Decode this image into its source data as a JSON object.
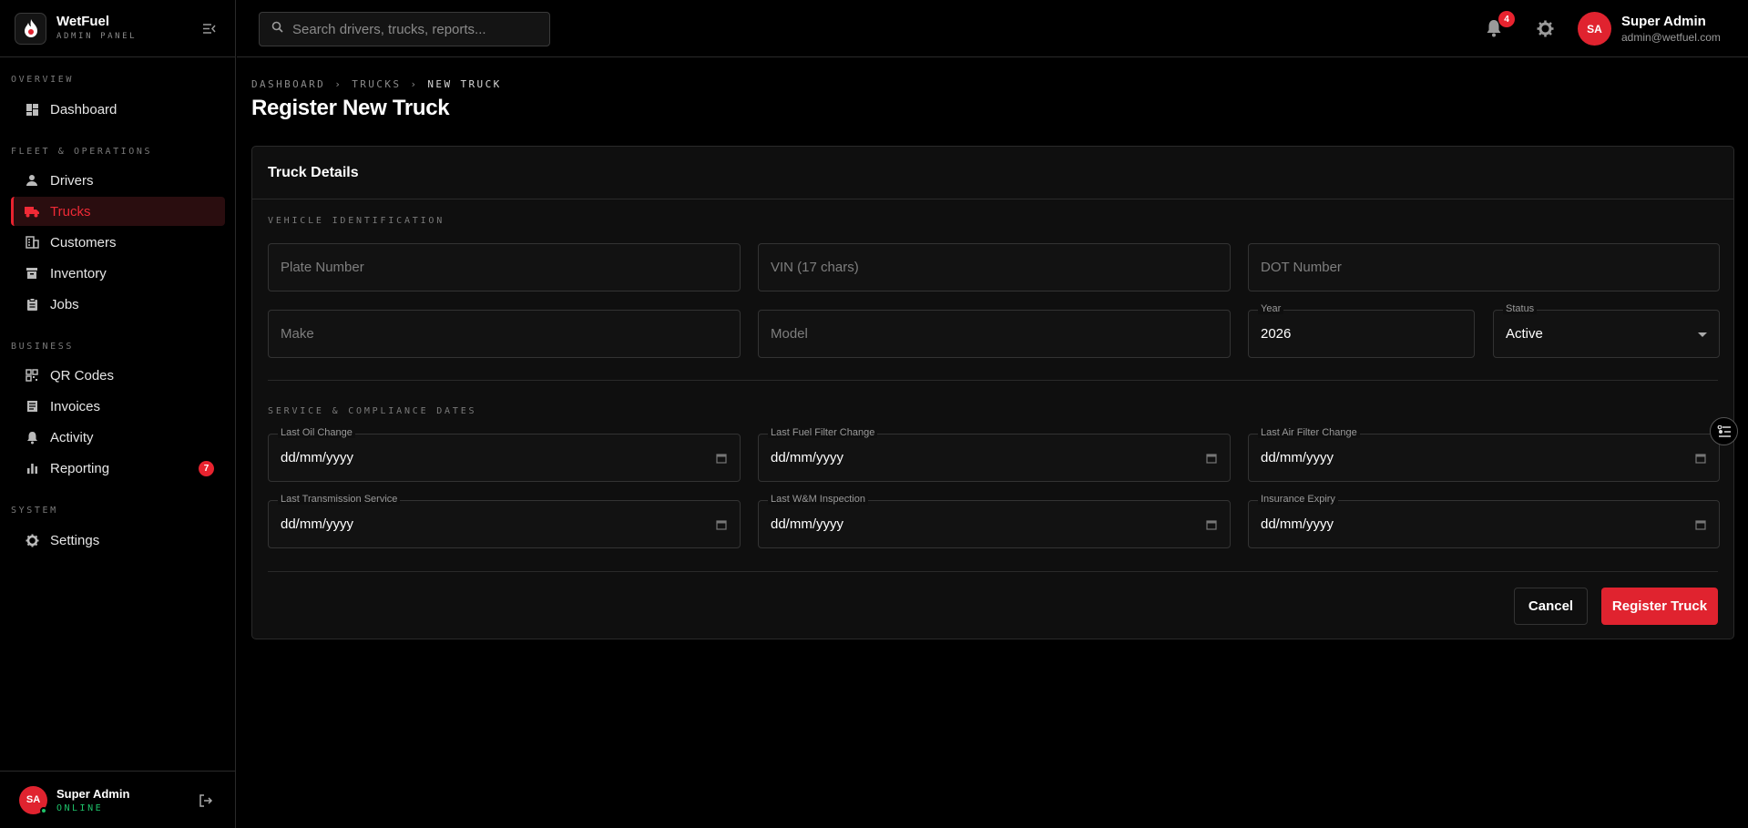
{
  "brand": {
    "name": "WetFuel",
    "subtitle": "ADMIN PANEL"
  },
  "sidebar": {
    "sections": [
      {
        "label": "OVERVIEW"
      },
      {
        "label": "FLEET & OPERATIONS"
      },
      {
        "label": "BUSINESS"
      },
      {
        "label": "SYSTEM"
      }
    ],
    "items": [
      {
        "label": "Dashboard",
        "icon": "dashboard-icon"
      },
      {
        "label": "Drivers",
        "icon": "person-icon"
      },
      {
        "label": "Trucks",
        "icon": "truck-icon",
        "active": true
      },
      {
        "label": "Customers",
        "icon": "building-icon"
      },
      {
        "label": "Inventory",
        "icon": "archive-icon"
      },
      {
        "label": "Jobs",
        "icon": "clipboard-icon"
      },
      {
        "label": "QR Codes",
        "icon": "qr-code-icon"
      },
      {
        "label": "Invoices",
        "icon": "receipt-icon"
      },
      {
        "label": "Activity",
        "icon": "bell-icon"
      },
      {
        "label": "Reporting",
        "icon": "bar-chart-icon",
        "badge": "7"
      },
      {
        "label": "Settings",
        "icon": "gear-icon"
      }
    ],
    "footer": {
      "initials": "SA",
      "name": "Super Admin",
      "status": "ONLINE"
    }
  },
  "topbar": {
    "search_placeholder": "Search drivers, trucks, reports...",
    "notification_count": "4",
    "user": {
      "initials": "SA",
      "name": "Super Admin",
      "email": "admin@wetfuel.com"
    }
  },
  "breadcrumb": [
    "DASHBOARD",
    "TRUCKS",
    "NEW TRUCK"
  ],
  "breadcrumb_separator": "›",
  "page_title": "Register New Truck",
  "form": {
    "card_title": "Truck Details",
    "vehicle_section": "VEHICLE IDENTIFICATION",
    "plate_placeholder": "Plate Number",
    "vin_placeholder": "VIN (17 chars)",
    "dot_placeholder": "DOT Number",
    "make_placeholder": "Make",
    "model_placeholder": "Model",
    "year_label": "Year",
    "year_value": "2026",
    "status_label": "Status",
    "status_value": "Active",
    "service_section": "SERVICE & COMPLIANCE DATES",
    "date_fields": [
      {
        "label": "Last Oil Change",
        "value": "dd/mm/yyyy"
      },
      {
        "label": "Last Fuel Filter Change",
        "value": "dd/mm/yyyy"
      },
      {
        "label": "Last Air Filter Change",
        "value": "dd/mm/yyyy"
      },
      {
        "label": "Last Transmission Service",
        "value": "dd/mm/yyyy"
      },
      {
        "label": "Last W&M Inspection",
        "value": "dd/mm/yyyy"
      },
      {
        "label": "Insurance Expiry",
        "value": "dd/mm/yyyy"
      }
    ],
    "cancel_label": "Cancel",
    "submit_label": "Register Truck"
  },
  "colors": {
    "accent": "#e0232f",
    "online": "#1ec36a",
    "background": "#000000",
    "card": "#0f0f0f"
  }
}
